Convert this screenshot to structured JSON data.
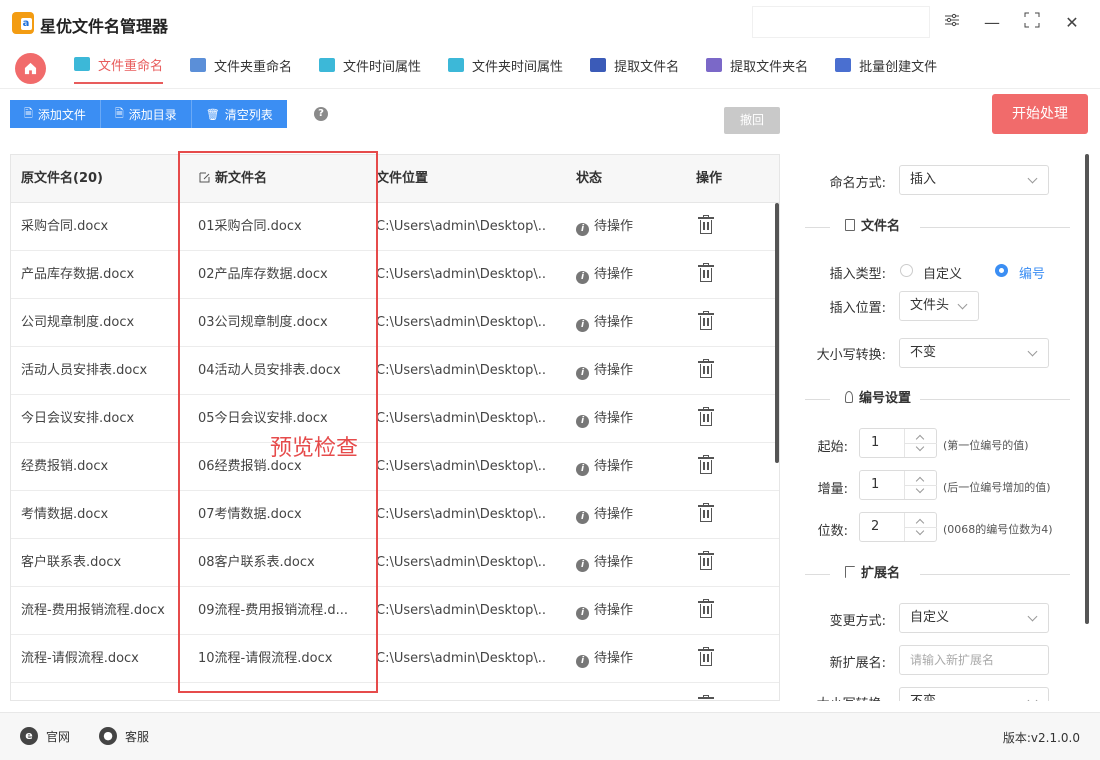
{
  "app": {
    "title": "星优文件名管理器",
    "logo_letter": "a"
  },
  "window": {
    "settings_icon": "sliders-icon",
    "minimize": "—",
    "maximize": "⛶",
    "close": "✕"
  },
  "tabs": [
    {
      "label": "文件重命名",
      "active": true,
      "color": "#3cb8d8"
    },
    {
      "label": "文件夹重命名",
      "active": false,
      "color": "#5b8fd8"
    },
    {
      "label": "文件时间属性",
      "active": false,
      "color": "#3cb8d8"
    },
    {
      "label": "文件夹时间属性",
      "active": false,
      "color": "#3cb8d8"
    },
    {
      "label": "提取文件名",
      "active": false,
      "color": "#3b5bb8"
    },
    {
      "label": "提取文件夹名",
      "active": false,
      "color": "#7b68c8"
    },
    {
      "label": "批量创建文件",
      "active": false,
      "color": "#4a6fd0"
    }
  ],
  "toolbar": {
    "add_file": "添加文件",
    "add_dir": "添加目录",
    "clear_list": "清空列表",
    "help": "?",
    "undo": "撤回",
    "start": "开始处理"
  },
  "table": {
    "headers": {
      "original": "原文件名(20)",
      "new": "新文件名",
      "location": "文件位置",
      "status": "状态",
      "action": "操作"
    },
    "rows": [
      {
        "original": "采购合同.docx",
        "new": "01采购合同.docx",
        "location": "C:\\Users\\admin\\Desktop\\...",
        "status": "待操作"
      },
      {
        "original": "产品库存数据.docx",
        "new": "02产品库存数据.docx",
        "location": "C:\\Users\\admin\\Desktop\\...",
        "status": "待操作"
      },
      {
        "original": "公司规章制度.docx",
        "new": "03公司规章制度.docx",
        "location": "C:\\Users\\admin\\Desktop\\...",
        "status": "待操作"
      },
      {
        "original": "活动人员安排表.docx",
        "new": "04活动人员安排表.docx",
        "location": "C:\\Users\\admin\\Desktop\\...",
        "status": "待操作"
      },
      {
        "original": "今日会议安排.docx",
        "new": "05今日会议安排.docx",
        "location": "C:\\Users\\admin\\Desktop\\...",
        "status": "待操作"
      },
      {
        "original": "经费报销.docx",
        "new": "06经费报销.docx",
        "location": "C:\\Users\\admin\\Desktop\\...",
        "status": "待操作"
      },
      {
        "original": "考情数据.docx",
        "new": "07考情数据.docx",
        "location": "C:\\Users\\admin\\Desktop\\...",
        "status": "待操作"
      },
      {
        "original": "客户联系表.docx",
        "new": "08客户联系表.docx",
        "location": "C:\\Users\\admin\\Desktop\\...",
        "status": "待操作"
      },
      {
        "original": "流程-费用报销流程.docx",
        "new": "09流程-费用报销流程.d...",
        "location": "C:\\Users\\admin\\Desktop\\...",
        "status": "待操作"
      },
      {
        "original": "流程-请假流程.docx",
        "new": "10流程-请假流程.docx",
        "location": "C:\\Users\\admin\\Desktop\\...",
        "status": "待操作"
      }
    ],
    "overlay_label": "预览检查"
  },
  "panel": {
    "naming_mode_label": "命名方式:",
    "naming_mode_value": "插入",
    "filename_section": "文件名",
    "insert_type_label": "插入类型:",
    "insert_type_opt1": "自定义",
    "insert_type_opt2": "编号",
    "insert_type_selected": "编号",
    "insert_pos_label": "插入位置:",
    "insert_pos_value": "文件头",
    "case_label": "大小写转换:",
    "case_value": "不变",
    "numbering_section": "编号设置",
    "start_label": "起始:",
    "start_value": "1",
    "start_hint": "(第一位编号的值)",
    "step_label": "增量:",
    "step_value": "1",
    "step_hint": "(后一位编号增加的值)",
    "digits_label": "位数:",
    "digits_value": "2",
    "digits_hint": "(0068的编号位数为4)",
    "ext_section": "扩展名",
    "ext_mode_label": "变更方式:",
    "ext_mode_value": "自定义",
    "new_ext_label": "新扩展名:",
    "new_ext_placeholder": "请输入新扩展名",
    "ext_case_label": "大小写转换:",
    "ext_case_value": "不变"
  },
  "footer": {
    "website": "官网",
    "support": "客服",
    "version": "版本:v2.1.0.0"
  }
}
